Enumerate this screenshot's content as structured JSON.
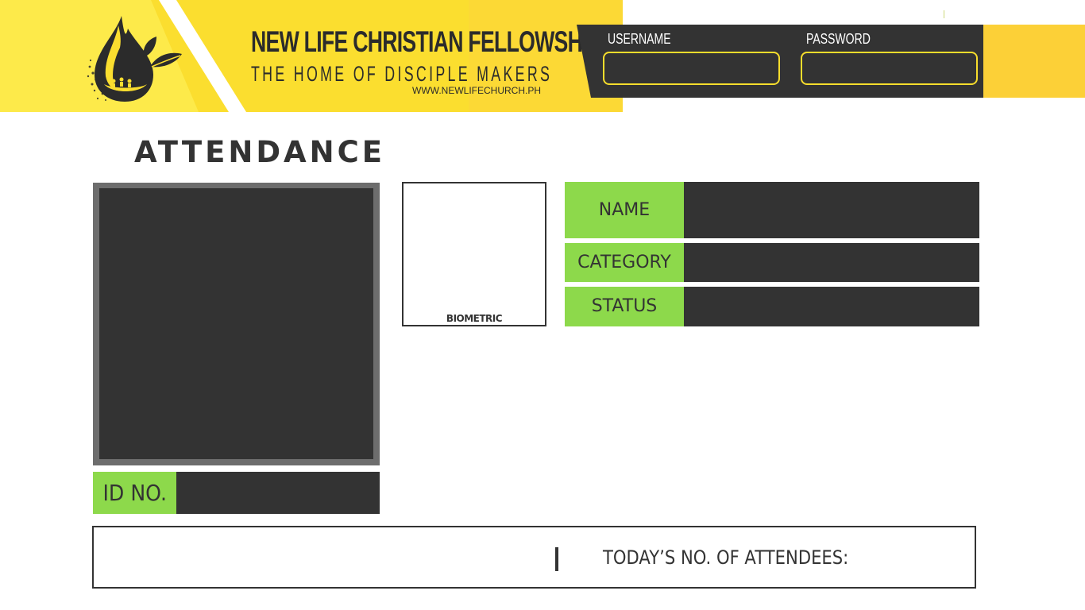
{
  "header": {
    "org_name": "NEW LIFE CHRISTIAN FELLOWSHIP",
    "tagline": "THE HOME OF DISCIPLE MAKERS",
    "website": "WWW.NEWLIFECHURCH.PH",
    "logo_icon": "flame-drop-leaf-logo-icon"
  },
  "login": {
    "username_label": "USERNAME",
    "username_value": "",
    "password_label": "PASSWORD",
    "password_value": ""
  },
  "page": {
    "title": "ATTENDANCE"
  },
  "photo": {
    "icon": "member-photo-placeholder"
  },
  "id": {
    "label": "ID NO.",
    "value": ""
  },
  "biometric": {
    "label": "BIOMETRIC"
  },
  "info": {
    "name_label": "NAME",
    "name_value": "",
    "category_label": "CATEGORY",
    "category_value": "",
    "status_label": "STATUS",
    "status_value": ""
  },
  "footer": {
    "attendees_label": "TODAY’S NO. OF ATTENDEES:",
    "attendees_value": ""
  },
  "colors": {
    "brand_yellow": "#fbde2f",
    "accent_green": "#8dd94b",
    "dark_panel": "#333333",
    "input_border": "#f7dd2c"
  }
}
